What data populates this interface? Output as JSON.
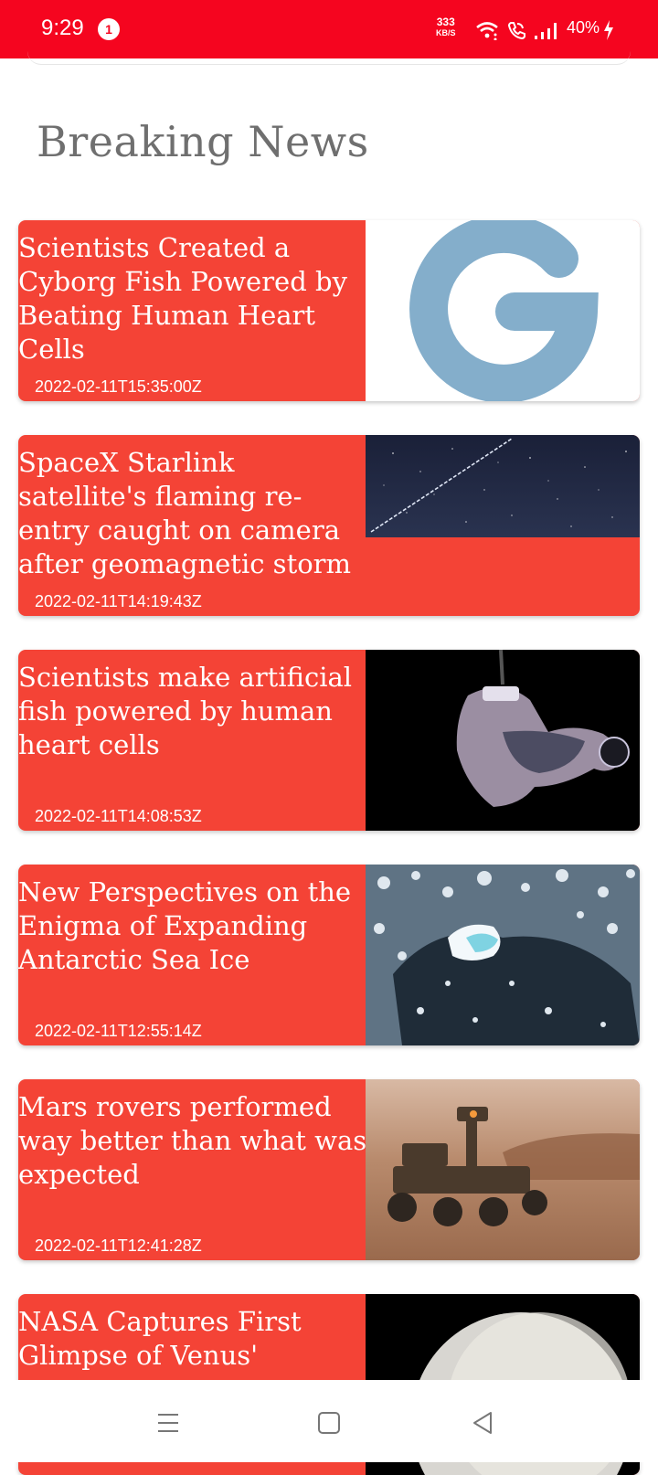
{
  "status_bar": {
    "time": "9:29",
    "notification_count": "1",
    "net_speed_value": "333",
    "net_speed_unit": "KB/S",
    "battery": "40%"
  },
  "page": {
    "title": "Breaking News"
  },
  "articles": [
    {
      "title": "Scientists Created a Cyborg Fish Powered by Beating Human Heart Cells",
      "date": "2022-02-11T15:35:00Z",
      "image": "letter-g-logo"
    },
    {
      "title": "SpaceX Starlink satellite's flaming re-entry caught on camera after geomagnetic storm",
      "date": "2022-02-11T14:19:43Z",
      "image": "night-sky-satellite-trail"
    },
    {
      "title": "Scientists make artificial fish powered by human heart cells",
      "date": "2022-02-11T14:08:53Z",
      "image": "artificial-fish"
    },
    {
      "title": "New Perspectives on the Enigma of Expanding Antarctic Sea Ice",
      "date": "2022-02-11T12:55:14Z",
      "image": "sea-ice"
    },
    {
      "title": "Mars rovers performed way better than what was expected",
      "date": "2022-02-11T12:41:28Z",
      "image": "mars-rover"
    },
    {
      "title": "NASA Captures First Glimpse of Venus'",
      "date": "",
      "image": "venus-planet"
    }
  ],
  "colors": {
    "status_bar": "#f5051f",
    "card_background": "#f44336",
    "title_gray": "#6f6f6f"
  }
}
